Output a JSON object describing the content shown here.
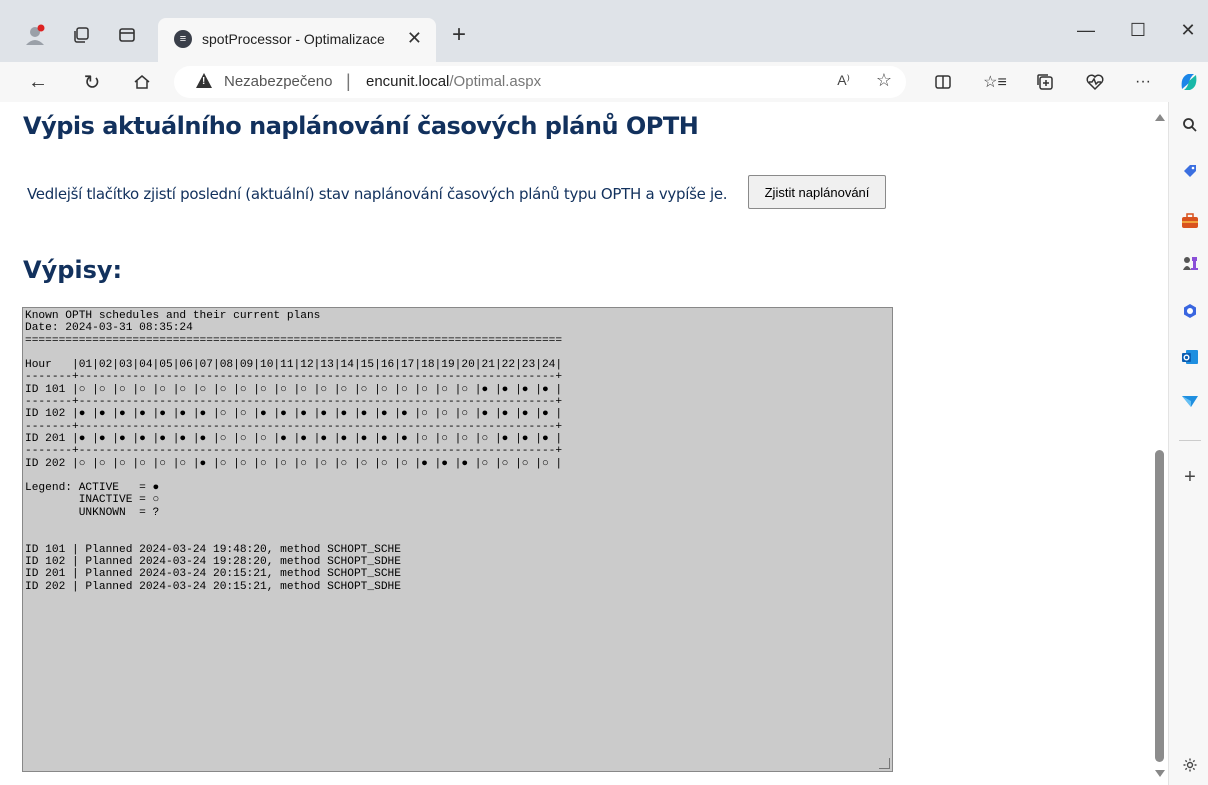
{
  "browser": {
    "tab_title": "spotProcessor - Optimalizace",
    "tab_close": "✕",
    "new_tab": "+",
    "insecure_label": "Nezabezpečeno",
    "url_host": "encunit.local",
    "url_path": "/Optimal.aspx",
    "read_aloud": "A⁾",
    "minimize": "—",
    "maximize": "☐",
    "close": "✕"
  },
  "page": {
    "title": "Výpis aktuálního naplánování časových plánů OPTH",
    "description": "Vedlejší tlačítko zjistí poslední (aktuální) stav naplánování časových plánů typu OPTH a vypíše je.",
    "button_label": "Zjistit naplánování",
    "section_heading": "Výpisy:",
    "output_text": "Known OPTH schedules and their current plans\nDate: 2024-03-31 08:35:24\n================================================================================\n\nHour   |01|02|03|04|05|06|07|08|09|10|11|12|13|14|15|16|17|18|19|20|21|22|23|24|\n-------+-----------------------------------------------------------------------+\nID 101 |○ |○ |○ |○ |○ |○ |○ |○ |○ |○ |○ |○ |○ |○ |○ |○ |○ |○ |○ |○ |● |● |● |● |\n-------+-----------------------------------------------------------------------+\nID 102 |● |● |● |● |● |● |● |○ |○ |● |● |● |● |● |● |● |● |○ |○ |○ |● |● |● |● |\n-------+-----------------------------------------------------------------------+\nID 201 |● |● |● |● |● |● |● |○ |○ |○ |● |● |● |● |● |● |● |○ |○ |○ |○ |● |● |● |\n-------+-----------------------------------------------------------------------+\nID 202 |○ |○ |○ |○ |○ |○ |● |○ |○ |○ |○ |○ |○ |○ |○ |○ |○ |● |● |● |○ |○ |○ |○ |\n\nLegend: ACTIVE   = ●\n        INACTIVE = ○\n        UNKNOWN  = ?\n\n\nID 101 | Planned 2024-03-24 19:48:20, method SCHOPT_SCHE\nID 102 | Planned 2024-03-24 19:28:20, method SCHOPT_SDHE\nID 201 | Planned 2024-03-24 20:15:21, method SCHOPT_SCHE\nID 202 | Planned 2024-03-24 20:15:21, method SCHOPT_SDHE"
  }
}
